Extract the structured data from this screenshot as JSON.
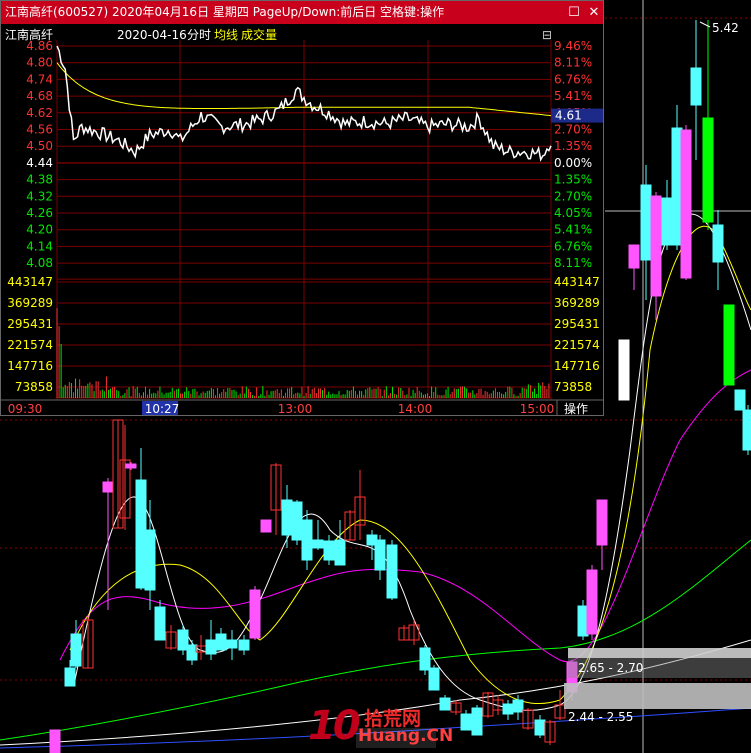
{
  "window": {
    "title": "江南高纤(600527) 2020年04月16日 星期四 PageUp/Down:前后日 空格键:操作",
    "restore_symbol": "☐",
    "close_symbol": "✕"
  },
  "intraday": {
    "header": {
      "name": "江南高纤",
      "date": "2020-04-16",
      "period": "分时",
      "avg_label": "均线",
      "vol_label": "成交量"
    },
    "price_labels": [
      "4.86",
      "4.80",
      "4.74",
      "4.68",
      "4.62",
      "4.56",
      "4.50",
      "4.44",
      "4.38",
      "4.32",
      "4.26",
      "4.20",
      "4.14",
      "4.08"
    ],
    "pct_labels": [
      "9.46%",
      "8.11%",
      "6.76%",
      "5.41%",
      "4.05%",
      "2.70%",
      "1.35%",
      "0.00%",
      "1.35%",
      "2.70%",
      "4.05%",
      "5.41%",
      "6.76%",
      "8.11%"
    ],
    "current_price": "4.61",
    "volume_labels": [
      "443147",
      "369289",
      "295431",
      "221574",
      "147716",
      "73858"
    ],
    "time_labels": [
      "09:30",
      "10:27",
      "13:00",
      "14:00",
      "15:00"
    ],
    "operate_label": "操作",
    "colors": {
      "up": "#ff3232",
      "down": "#00e600",
      "price_line": "#ffffff",
      "avg_line": "#ffff00",
      "grid": "#7a0000"
    }
  },
  "kline": {
    "labels": {
      "high": "5.42",
      "zone_upper": "2.65 - 2.70",
      "zone_lower": "2.44 - 2.55"
    },
    "colors": {
      "up_candle": "#ff55ff",
      "up_candle_outline": "#ff3232",
      "down_candle": "#55ffff",
      "big_down": "#00ff00",
      "ma5": "#ffffff",
      "ma10": "#ffff00",
      "ma20": "#ff00ff",
      "ma60": "#00ff00",
      "ma120": "#ffffff",
      "ma250": "#3050ff"
    }
  },
  "watermark": {
    "num": "10",
    "cn": "拾荒网",
    "en": "Huang.CN"
  }
}
